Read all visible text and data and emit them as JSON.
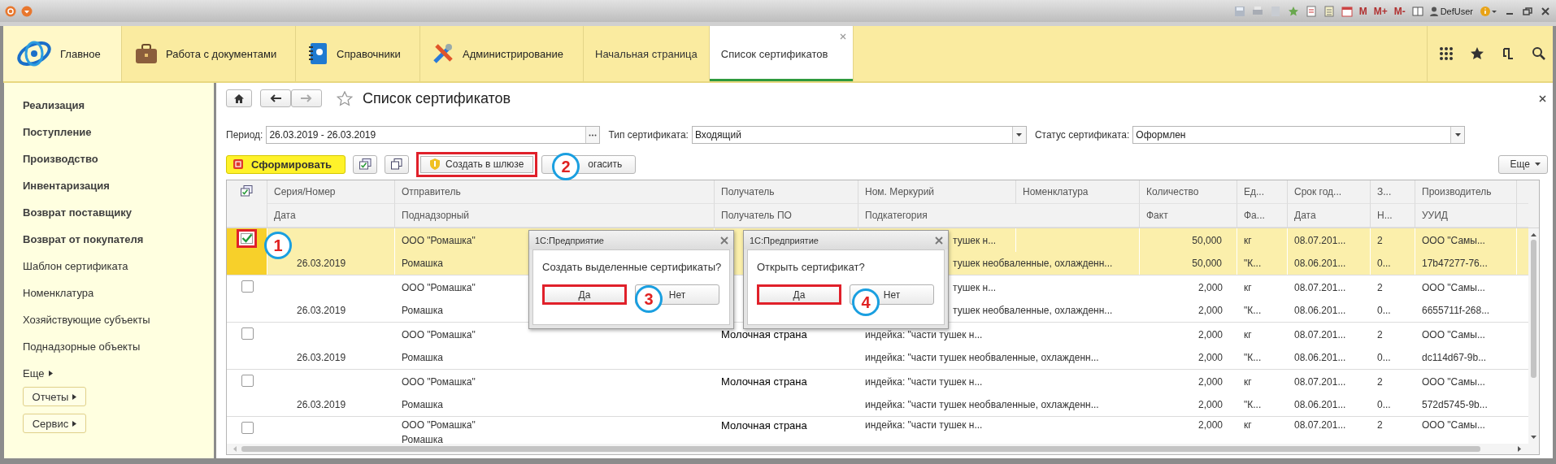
{
  "titlebar": {
    "memory_buttons": [
      "M",
      "M+",
      "M-"
    ],
    "user": "DefUser"
  },
  "sections": [
    {
      "label": "Главное"
    },
    {
      "label": "Работа с документами"
    },
    {
      "label": "Справочники"
    },
    {
      "label": "Администрирование"
    }
  ],
  "tabs": [
    {
      "label": "Начальная страница",
      "selected": false,
      "closable": false
    },
    {
      "label": "Список сертификатов",
      "selected": true,
      "closable": true
    }
  ],
  "sidebar": {
    "items": [
      {
        "label": "Реализация",
        "bold": true
      },
      {
        "label": "Поступление",
        "bold": true
      },
      {
        "label": "Производство",
        "bold": true
      },
      {
        "label": "Инвентаризация",
        "bold": true
      },
      {
        "label": "Возврат поставщику",
        "bold": true
      },
      {
        "label": "Возврат от покупателя",
        "bold": true
      },
      {
        "label": "Шаблон сертификата",
        "bold": false
      },
      {
        "label": "Номенклатура",
        "bold": false
      },
      {
        "label": "Хозяйствующие субъекты",
        "bold": false
      },
      {
        "label": "Поднадзорные объекты",
        "bold": false
      }
    ],
    "more": "Еще",
    "buttons": [
      "Отчеты",
      "Сервис"
    ]
  },
  "form": {
    "title": "Список сертификатов",
    "filters": [
      {
        "kind": "period",
        "label": "Период:",
        "value": "26.03.2019 - 26.03.2019"
      },
      {
        "kind": "dropdown",
        "label": "Тип сертификата:",
        "value": "Входящий"
      },
      {
        "kind": "dropdown",
        "label": "Статус сертификата:",
        "value": "Оформлен"
      }
    ],
    "toolbar": [
      {
        "kind": "primary",
        "label": "Сформировать",
        "highlighted": false
      },
      {
        "kind": "icon",
        "highlighted": false
      },
      {
        "kind": "icon",
        "highlighted": false
      },
      {
        "kind": "text",
        "label": "Создать в шлюзе",
        "highlighted": true
      },
      {
        "kind": "text",
        "label": "огасить",
        "highlighted": false
      }
    ],
    "more": "Еще"
  },
  "table": {
    "header_1": [
      "Серия/Номер",
      "Отправитель",
      "Получатель",
      "Ном. Меркурий",
      "Номенклатура",
      "Количество",
      "Ед...",
      "Срок год...",
      "З...",
      "Производитель"
    ],
    "header_2": [
      "Дата",
      "Поднадзорный",
      "Получатель ПО",
      "Подкатегория",
      "Факт",
      "Фа...",
      "Дата",
      "Н...",
      "УУИД"
    ],
    "records": [
      {
        "selected": true,
        "checked": true,
        "highlighted": true,
        "sender": "ООО \"Ромашка\"",
        "mercury_nomenclature": "тушек н...",
        "quantity": "50,000",
        "unit": "кг",
        "shelf_life": "08.07.201...",
        "column_z": "2",
        "producer": "ООО \"Самы...",
        "date": "26.03.2019",
        "supervised": "Ромашка",
        "subcategory": "тушек необваленные, охлажденн...",
        "fact": "50,000",
        "unit_fact": "\"К...",
        "date_2": "08.06.201...",
        "column_n": "0...",
        "uuid": "17b47277-76..."
      },
      {
        "selected": false,
        "checked": false,
        "highlighted": false,
        "sender": "ООО \"Ромашка\"",
        "mercury_nomenclature": "тушек н...",
        "quantity": "2,000",
        "unit": "кг",
        "shelf_life": "08.07.201...",
        "column_z": "2",
        "producer": "ООО \"Самы...",
        "date": "26.03.2019",
        "supervised": "Ромашка",
        "subcategory": "тушек необваленные, охлажденн...",
        "fact": "2,000",
        "unit_fact": "\"К...",
        "date_2": "08.06.201...",
        "column_n": "0...",
        "uuid": "6655711f-268..."
      },
      {
        "selected": false,
        "checked": false,
        "highlighted": false,
        "sender": "ООО \"Ромашка\"",
        "recipient": "Молочная страна",
        "mercury_nomenclature": "индейка: \"части тушек н...",
        "quantity": "2,000",
        "unit": "кг",
        "shelf_life": "08.07.201...",
        "column_z": "2",
        "producer": "ООО \"Самы...",
        "date": "26.03.2019",
        "supervised": "Ромашка",
        "subcategory": "индейка: \"части тушек необваленные, охлажденн...",
        "fact": "2,000",
        "unit_fact": "\"К...",
        "date_2": "08.06.201...",
        "column_n": "0...",
        "uuid": "dc114d67-9b..."
      },
      {
        "selected": false,
        "checked": false,
        "highlighted": false,
        "sender": "ООО \"Ромашка\"",
        "recipient": "Молочная страна",
        "mercury_nomenclature": "индейка: \"части тушек н...",
        "quantity": "2,000",
        "unit": "кг",
        "shelf_life": "08.07.201...",
        "column_z": "2",
        "producer": "ООО \"Самы...",
        "date": "26.03.2019",
        "supervised": "Ромашка",
        "subcategory": "индейка: \"части тушек необваленные, охлажденн...",
        "fact": "2,000",
        "unit_fact": "\"К...",
        "date_2": "08.06.201...",
        "column_n": "0...",
        "uuid": "572d5745-9b..."
      },
      {
        "selected": false,
        "checked": false,
        "highlighted": false,
        "sender": "ООО \"Ромашка\"",
        "recipient": "Молочная страна",
        "mercury_nomenclature": "индейка: \"части тушек н...",
        "quantity": "2,000",
        "unit": "кг",
        "shelf_life": "08.07.201...",
        "column_z": "2",
        "producer": "ООО \"Самы...",
        "supervised": "Ромашка"
      }
    ]
  },
  "dialogs": [
    {
      "title": "1С:Предприятие",
      "message": "Создать выделенные сертификаты?",
      "buttons": [
        {
          "label": "Да",
          "highlighted": true
        },
        {
          "label": "Нет",
          "highlighted": false
        }
      ]
    },
    {
      "title": "1С:Предприятие",
      "message": "Открыть сертификат?",
      "buttons": [
        {
          "label": "Да",
          "highlighted": true
        },
        {
          "label": "Нет",
          "highlighted": false
        }
      ]
    }
  ],
  "callouts": [
    "1",
    "2",
    "3",
    "4"
  ]
}
